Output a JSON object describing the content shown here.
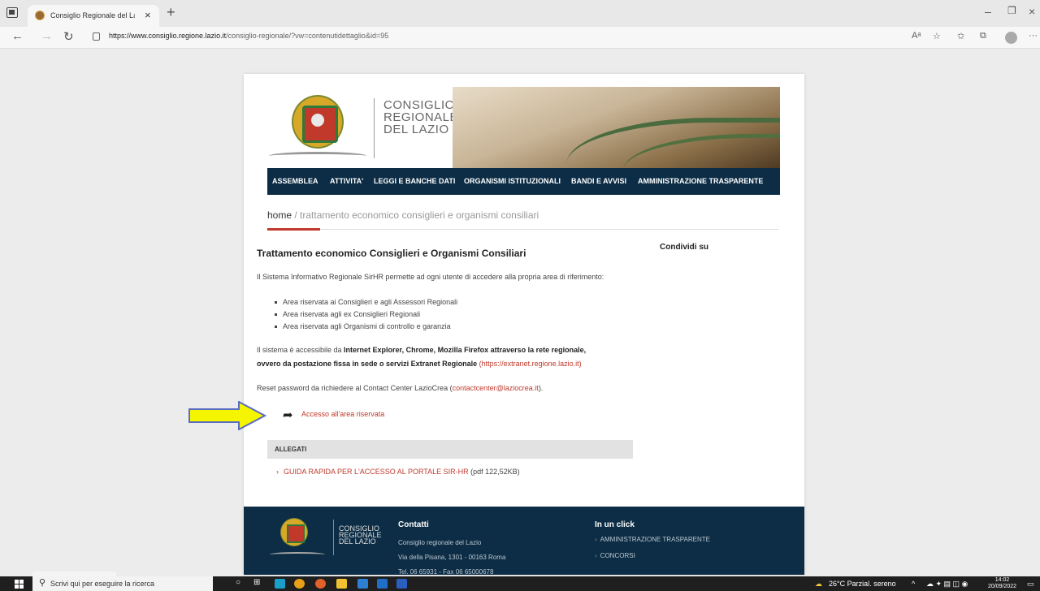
{
  "browser": {
    "tab_title": "Consiglio Regionale del Lazio - S",
    "url_domain": "https://www.consiglio.regione.lazio.it",
    "url_path": "/consiglio-regionale/?vw=contenutidettaglio&id=95"
  },
  "site": {
    "logo_lines": [
      "CONSIGLIO",
      "REGIONALE",
      "DEL LAZIO"
    ],
    "nav": [
      "ASSEMBLEA",
      "ATTIVITA'",
      "LEGGI E BANCHE DATI",
      "ORGANISMI ISTITUZIONALI",
      "BANDI E AVVISI",
      "AMMINISTRAZIONE TRASPARENTE"
    ]
  },
  "breadcrumb": {
    "home": "home",
    "separator": " / ",
    "current": "trattamento economico consiglieri e organismi consiliari"
  },
  "content": {
    "title": "Trattamento economico Consiglieri e Organismi Consiliari",
    "share_label": "Condividi su",
    "intro": "Il Sistema Informativo Regionale SirHR permette ad ogni utente di accedere alla propria area di riferimento:",
    "bullets": [
      "Area riservata ai Consiglieri e agli Assessori Regionali",
      "Area riservata agli ex Consiglieri Regionali",
      "Area riservata agli Organismi di controllo e garanzia"
    ],
    "access_p1": "Il sistema è accessibile da ",
    "access_bold_1": "Internet Explorer, Chrome, Mozilla Firefox attraverso la rete regionale,",
    "access_bold_2": "ovvero da postazione fissa in sede o servizi Extranet Regionale",
    "access_link": "(https://extranet.regione.lazio.it)",
    "reset_text": "Reset password da richiedere al Contact Center LazioCrea (",
    "reset_link": "contactcenter@laziocrea.it",
    "reset_end": ").",
    "access_area": "Accesso all'area riservata",
    "attachments_title": "ALLEGATI",
    "attachment_link": "GUIDA RAPIDA PER L'ACCESSO AL PORTALE SIR-HR",
    "attachment_meta": " (pdf 122,52KB)"
  },
  "footer": {
    "logo_lines": [
      "CONSIGLIO",
      "REGIONALE",
      "DEL LAZIO"
    ],
    "contacts_title": "Contatti",
    "contacts": [
      "Consiglio regionale del Lazio",
      "Via della Pisana, 1301 - 00163 Roma",
      "Tel. 06 65931 - Fax 06 65000678"
    ],
    "quick_title": "In un click",
    "quick_links": [
      "AMMINISTRAZIONE TRASPARENTE",
      "CONCORSI"
    ]
  },
  "taskbar": {
    "search_placeholder": "Scrivi qui per eseguire la ricerca",
    "weather": "26°C  Parzial. sereno",
    "time": "14:02",
    "date": "20/09/2022"
  },
  "colors": {
    "nav_bg": "#0c2d45",
    "accent_red": "#c0392b",
    "arrow_fill": "#f5f500"
  },
  "icons": [
    "windows-icon",
    "search-icon",
    "share-icon",
    "facebook-icon",
    "twitter-icon",
    "rss-icon",
    "chevron-right-icon"
  ]
}
